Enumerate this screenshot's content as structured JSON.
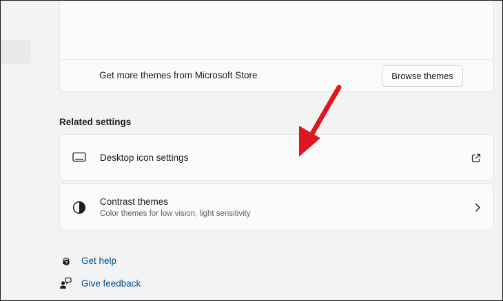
{
  "themes": {
    "store_text": "Get more themes from Microsoft Store",
    "browse_label": "Browse themes",
    "thumb_accents": [
      "#3d7c8f",
      "#44525c"
    ]
  },
  "related": {
    "header": "Related settings",
    "desktop_icon": {
      "title": "Desktop icon settings",
      "icon": "monitor-icon",
      "right_icon": "external-link-icon"
    },
    "contrast": {
      "title": "Contrast themes",
      "subtitle": "Color themes for low vision, light sensitivity",
      "icon": "contrast-icon",
      "right_icon": "chevron-right-icon"
    }
  },
  "help": {
    "get_help": "Get help",
    "give_feedback": "Give feedback"
  },
  "colors": {
    "link": "#00508a",
    "annotation_arrow": "#e0161f"
  }
}
